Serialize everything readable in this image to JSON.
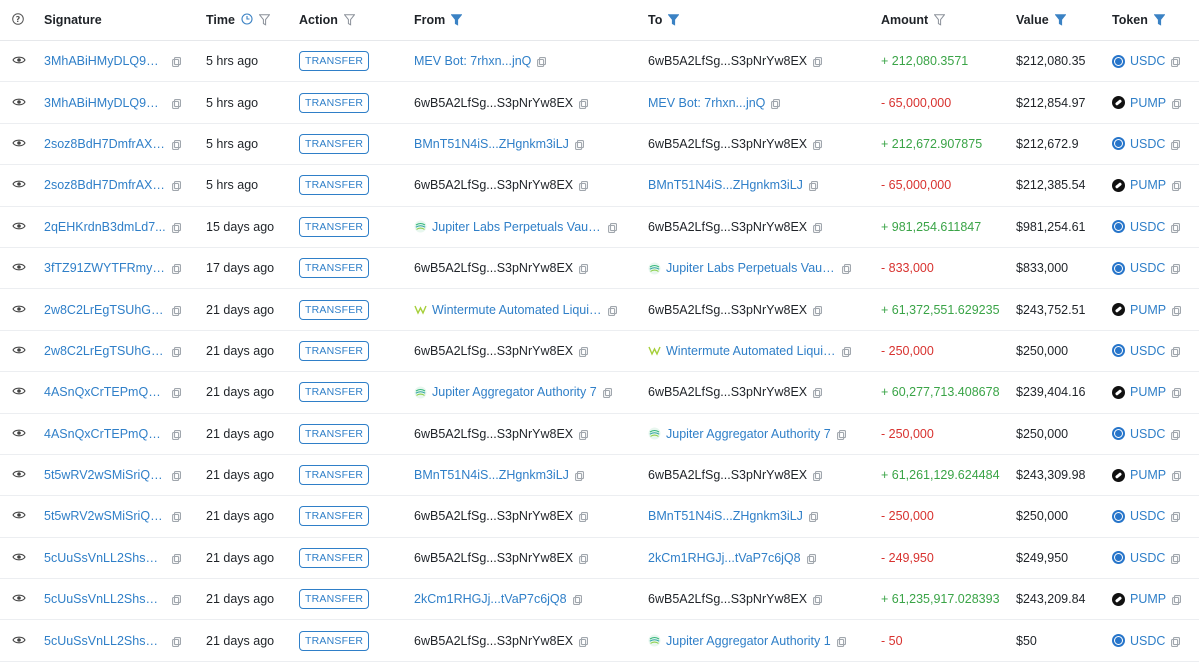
{
  "headers": {
    "signature": "Signature",
    "time": "Time",
    "action": "Action",
    "from": "From",
    "to": "To",
    "amount": "Amount",
    "value": "Value",
    "token": "Token"
  },
  "colors": {
    "link": "#2f7fc8",
    "positive": "#3aa447",
    "negative": "#d8322f",
    "usdc": "#2775ca",
    "pump": "#111111"
  },
  "rows": [
    {
      "signature": "3MhABiHMyDLQ9M1...",
      "time": "5 hrs ago",
      "action": "TRANSFER",
      "from": "MEV Bot: 7rhxn...jnQ",
      "from_link": true,
      "from_icon": "",
      "to": "6wB5A2LfSg...S3pNrYw8EX",
      "to_link": false,
      "to_icon": "",
      "amount": "+ 212,080.3571",
      "sign": "pos",
      "value": "$212,080.35",
      "token": "USDC",
      "token_icon": "usdc-icon"
    },
    {
      "signature": "3MhABiHMyDLQ9M1...",
      "time": "5 hrs ago",
      "action": "TRANSFER",
      "from": "6wB5A2LfSg...S3pNrYw8EX",
      "from_link": false,
      "from_icon": "",
      "to": "MEV Bot: 7rhxn...jnQ",
      "to_link": true,
      "to_icon": "",
      "amount": "- 65,000,000",
      "sign": "neg",
      "value": "$212,854.97",
      "token": "PUMP",
      "token_icon": "pump-icon"
    },
    {
      "signature": "2soz8BdH7DmfrAXf...",
      "time": "5 hrs ago",
      "action": "TRANSFER",
      "from": "BMnT51N4iS...ZHgnkm3iLJ",
      "from_link": true,
      "from_icon": "",
      "to": "6wB5A2LfSg...S3pNrYw8EX",
      "to_link": false,
      "to_icon": "",
      "amount": "+ 212,672.907875",
      "sign": "pos",
      "value": "$212,672.9",
      "token": "USDC",
      "token_icon": "usdc-icon"
    },
    {
      "signature": "2soz8BdH7DmfrAXf...",
      "time": "5 hrs ago",
      "action": "TRANSFER",
      "from": "6wB5A2LfSg...S3pNrYw8EX",
      "from_link": false,
      "from_icon": "",
      "to": "BMnT51N4iS...ZHgnkm3iLJ",
      "to_link": true,
      "to_icon": "",
      "amount": "- 65,000,000",
      "sign": "neg",
      "value": "$212,385.54",
      "token": "PUMP",
      "token_icon": "pump-icon"
    },
    {
      "signature": "2qEHKrdnB3dmLd7...",
      "time": "15 days ago",
      "action": "TRANSFER",
      "from": "Jupiter Labs Perpetuals Vault ...",
      "from_link": true,
      "from_icon": "jupiter-icon",
      "to": "6wB5A2LfSg...S3pNrYw8EX",
      "to_link": false,
      "to_icon": "",
      "amount": "+ 981,254.611847",
      "sign": "pos",
      "value": "$981,254.61",
      "token": "USDC",
      "token_icon": "usdc-icon"
    },
    {
      "signature": "3fTZ91ZWYTFRmyo...",
      "time": "17 days ago",
      "action": "TRANSFER",
      "from": "6wB5A2LfSg...S3pNrYw8EX",
      "from_link": false,
      "from_icon": "",
      "to": "Jupiter Labs Perpetuals Vault ...",
      "to_link": true,
      "to_icon": "jupiter-icon",
      "amount": "- 833,000",
      "sign": "neg",
      "value": "$833,000",
      "token": "USDC",
      "token_icon": "usdc-icon"
    },
    {
      "signature": "2w8C2LrEgTSUhG7A...",
      "time": "21 days ago",
      "action": "TRANSFER",
      "from": "Wintermute Automated Liquidi...",
      "from_link": true,
      "from_icon": "wintermute-icon",
      "to": "6wB5A2LfSg...S3pNrYw8EX",
      "to_link": false,
      "to_icon": "",
      "amount": "+ 61,372,551.629235",
      "sign": "pos",
      "value": "$243,752.51",
      "token": "PUMP",
      "token_icon": "pump-icon"
    },
    {
      "signature": "2w8C2LrEgTSUhG7A...",
      "time": "21 days ago",
      "action": "TRANSFER",
      "from": "6wB5A2LfSg...S3pNrYw8EX",
      "from_link": false,
      "from_icon": "",
      "to": "Wintermute Automated Liquidi...",
      "to_link": true,
      "to_icon": "wintermute-icon",
      "amount": "- 250,000",
      "sign": "neg",
      "value": "$250,000",
      "token": "USDC",
      "token_icon": "usdc-icon"
    },
    {
      "signature": "4ASnQxCrTEPmQGJ...",
      "time": "21 days ago",
      "action": "TRANSFER",
      "from": "Jupiter Aggregator Authority 7",
      "from_link": true,
      "from_icon": "jupiter-icon",
      "to": "6wB5A2LfSg...S3pNrYw8EX",
      "to_link": false,
      "to_icon": "",
      "amount": "+ 60,277,713.408678",
      "sign": "pos",
      "value": "$239,404.16",
      "token": "PUMP",
      "token_icon": "pump-icon"
    },
    {
      "signature": "4ASnQxCrTEPmQGJ...",
      "time": "21 days ago",
      "action": "TRANSFER",
      "from": "6wB5A2LfSg...S3pNrYw8EX",
      "from_link": false,
      "from_icon": "",
      "to": "Jupiter Aggregator Authority 7",
      "to_link": true,
      "to_icon": "jupiter-icon",
      "amount": "- 250,000",
      "sign": "neg",
      "value": "$250,000",
      "token": "USDC",
      "token_icon": "usdc-icon"
    },
    {
      "signature": "5t5wRV2wSMiSriQ8...",
      "time": "21 days ago",
      "action": "TRANSFER",
      "from": "BMnT51N4iS...ZHgnkm3iLJ",
      "from_link": true,
      "from_icon": "",
      "to": "6wB5A2LfSg...S3pNrYw8EX",
      "to_link": false,
      "to_icon": "",
      "amount": "+ 61,261,129.624484",
      "sign": "pos",
      "value": "$243,309.98",
      "token": "PUMP",
      "token_icon": "pump-icon"
    },
    {
      "signature": "5t5wRV2wSMiSriQ8...",
      "time": "21 days ago",
      "action": "TRANSFER",
      "from": "6wB5A2LfSg...S3pNrYw8EX",
      "from_link": false,
      "from_icon": "",
      "to": "BMnT51N4iS...ZHgnkm3iLJ",
      "to_link": true,
      "to_icon": "",
      "amount": "- 250,000",
      "sign": "neg",
      "value": "$250,000",
      "token": "USDC",
      "token_icon": "usdc-icon"
    },
    {
      "signature": "5cUuSsVnLL2ShsA2...",
      "time": "21 days ago",
      "action": "TRANSFER",
      "from": "6wB5A2LfSg...S3pNrYw8EX",
      "from_link": false,
      "from_icon": "",
      "to": "2kCm1RHGJj...tVaP7c6jQ8",
      "to_link": true,
      "to_icon": "",
      "amount": "- 249,950",
      "sign": "neg",
      "value": "$249,950",
      "token": "USDC",
      "token_icon": "usdc-icon"
    },
    {
      "signature": "5cUuSsVnLL2ShsA2...",
      "time": "21 days ago",
      "action": "TRANSFER",
      "from": "2kCm1RHGJj...tVaP7c6jQ8",
      "from_link": true,
      "from_icon": "",
      "to": "6wB5A2LfSg...S3pNrYw8EX",
      "to_link": false,
      "to_icon": "",
      "amount": "+ 61,235,917.028393",
      "sign": "pos",
      "value": "$243,209.84",
      "token": "PUMP",
      "token_icon": "pump-icon"
    },
    {
      "signature": "5cUuSsVnLL2ShsA2...",
      "time": "21 days ago",
      "action": "TRANSFER",
      "from": "6wB5A2LfSg...S3pNrYw8EX",
      "from_link": false,
      "from_icon": "",
      "to": "Jupiter Aggregator Authority 1",
      "to_link": true,
      "to_icon": "jupiter-icon",
      "amount": "- 50",
      "sign": "neg",
      "value": "$50",
      "token": "USDC",
      "token_icon": "usdc-icon"
    }
  ]
}
